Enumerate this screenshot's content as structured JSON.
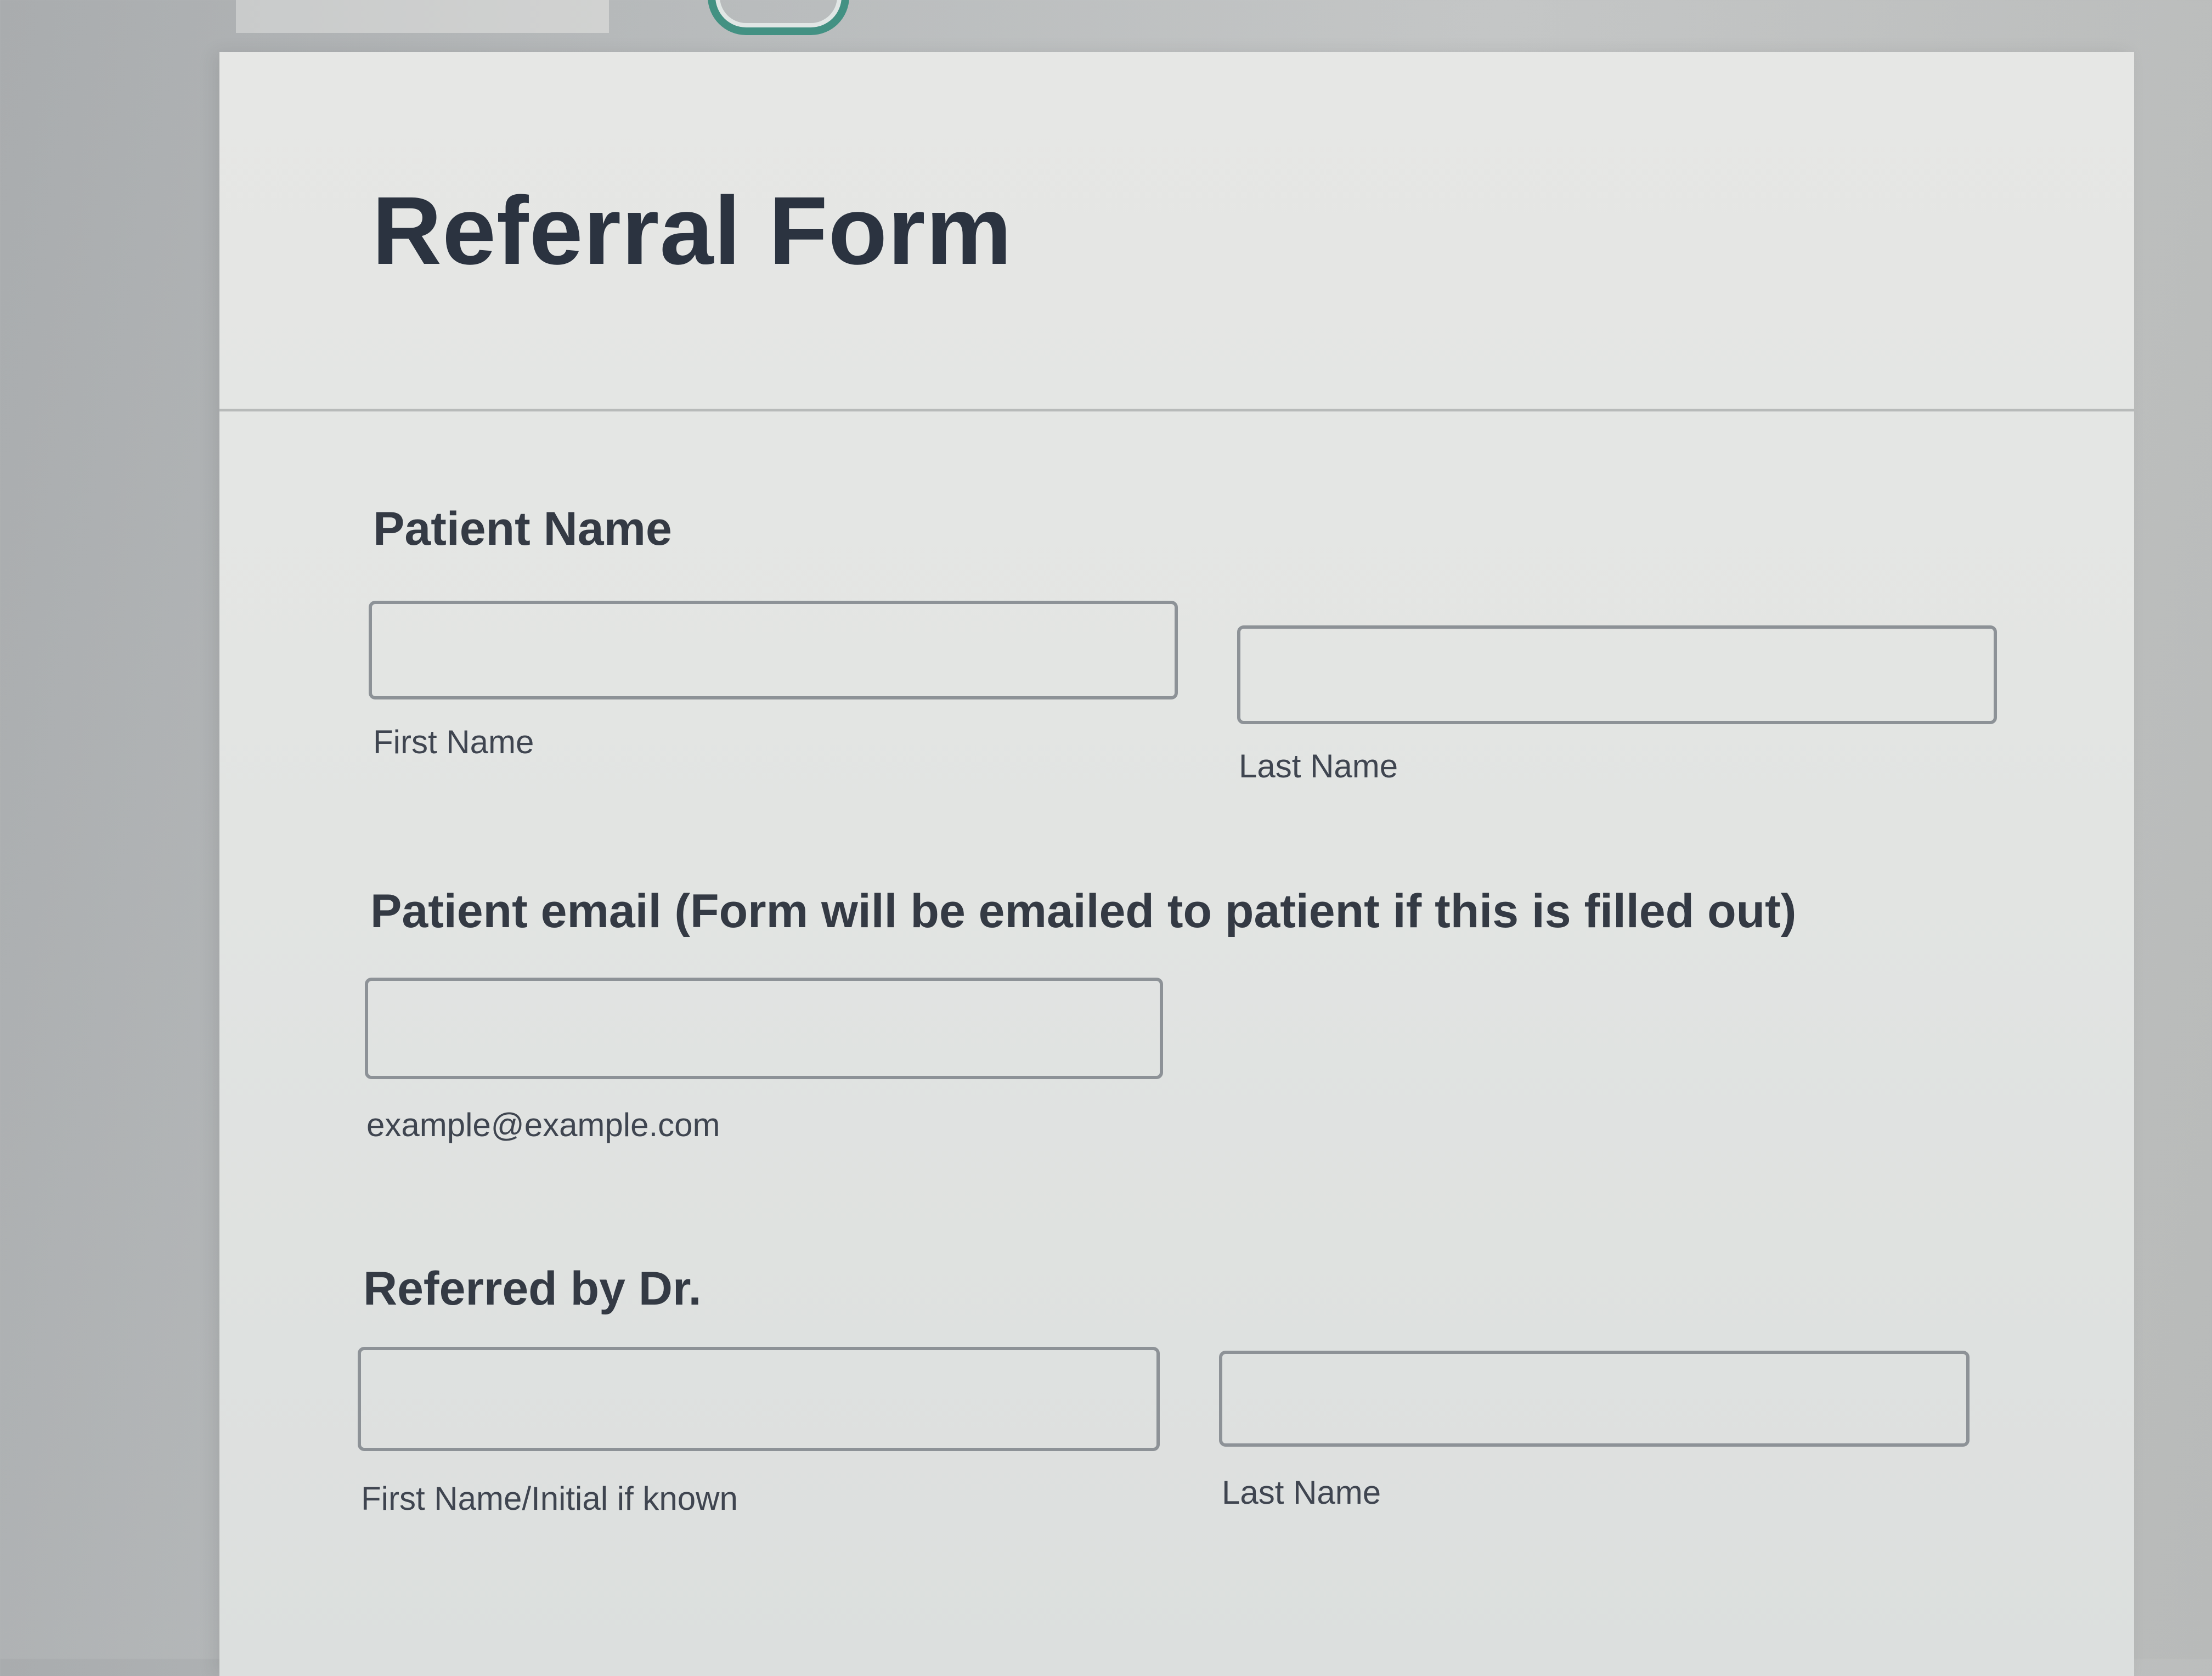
{
  "form": {
    "title": "Referral Form",
    "patient_name": {
      "label": "Patient Name",
      "first_name_value": "",
      "first_name_caption": "First Name",
      "last_name_value": "",
      "last_name_caption": "Last Name"
    },
    "patient_email": {
      "label": "Patient email (Form will be emailed to patient if this is filled out)",
      "value": "",
      "caption": "example@example.com"
    },
    "referred_by": {
      "label": "Referred by Dr.",
      "first_name_value": "",
      "first_name_caption": "First Name/Initial if known",
      "last_name_value": "",
      "last_name_caption": "Last Name"
    }
  },
  "colors": {
    "title_text": "#2b3340",
    "field_border": "#8d9297",
    "form_background": "#e4e6e4",
    "logo_accent": "#2f8a79"
  },
  "icons": {
    "logo": "brand-logo-icon"
  }
}
